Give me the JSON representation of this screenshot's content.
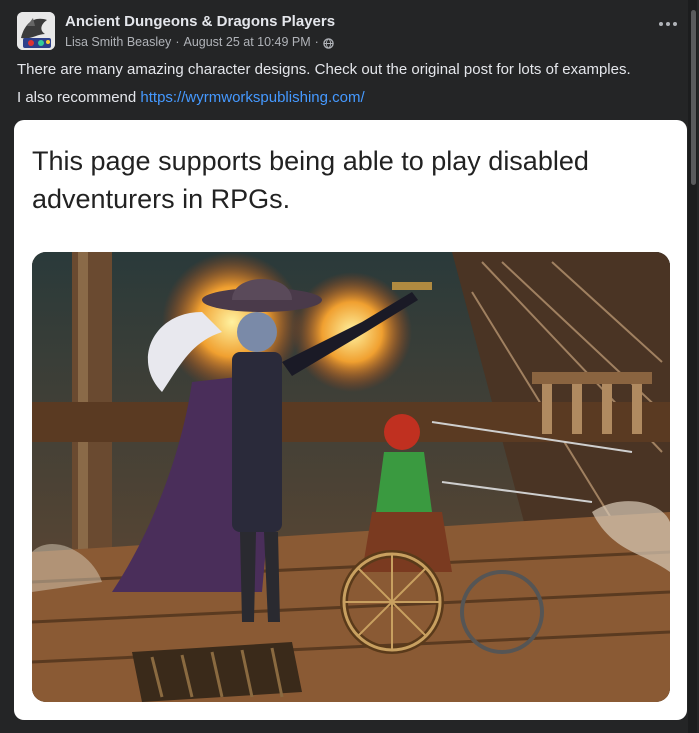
{
  "post": {
    "group_name": "Ancient Dungeons & Dragons Players",
    "author": "Lisa Smith Beasley",
    "date": "August 25 at 10:49 PM",
    "separator": "·",
    "audience_icon": "globe-icon",
    "more_icon": "more-horizontal-icon",
    "text_line_1": "There are many amazing character designs. Check out the original post for lots of examples.",
    "text_line_2_prefix": "I also recommend ",
    "link": "https://wyrmworkspublishing.com/"
  },
  "shared_image": {
    "caption": "This page supports being able to play disabled adventurers in RPGs.",
    "illustration": "pirate-ship-battle-illustration"
  },
  "colors": {
    "background": "#242526",
    "link": "#4599ff",
    "primary_text": "#e4e6eb",
    "secondary_text": "#b0b3b8"
  }
}
